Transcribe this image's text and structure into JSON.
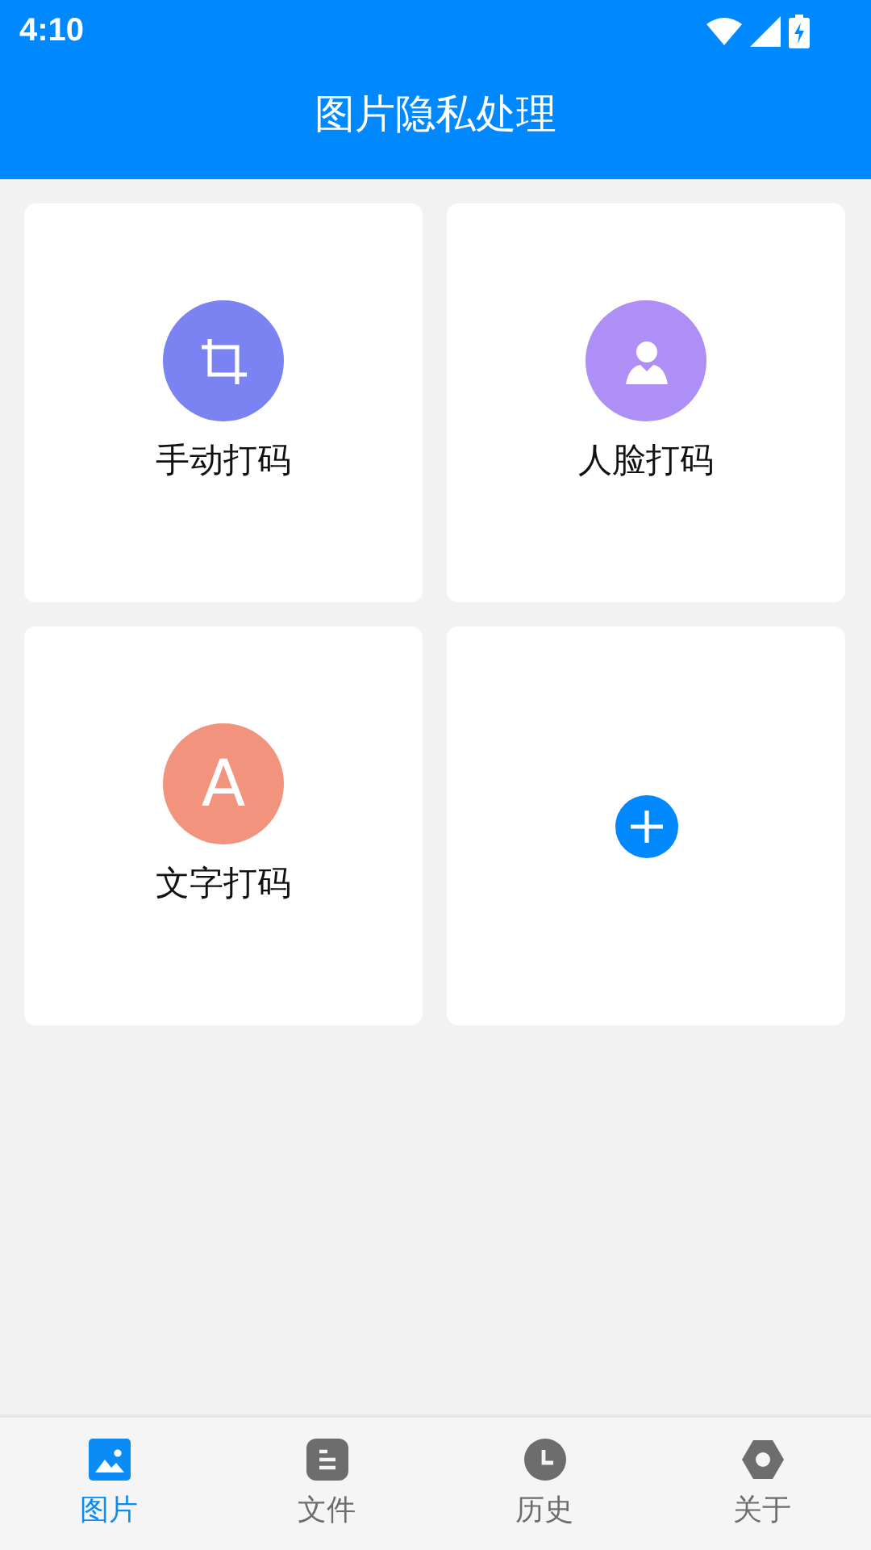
{
  "status_bar": {
    "time": "4:10"
  },
  "header": {
    "title": "图片隐私处理"
  },
  "cards": [
    {
      "kind": "crop",
      "color": "#7b82f2",
      "label": "手动打码"
    },
    {
      "kind": "face",
      "color": "#ae8ff5",
      "label": "人脸打码"
    },
    {
      "kind": "letter",
      "glyph": "A",
      "color": "#f2937d",
      "label": "文字打码"
    },
    {
      "kind": "add"
    }
  ],
  "bottom_nav": [
    {
      "label": "图片",
      "selected": true
    },
    {
      "label": "文件",
      "selected": false
    },
    {
      "label": "历史",
      "selected": false
    },
    {
      "label": "关于",
      "selected": false
    }
  ]
}
